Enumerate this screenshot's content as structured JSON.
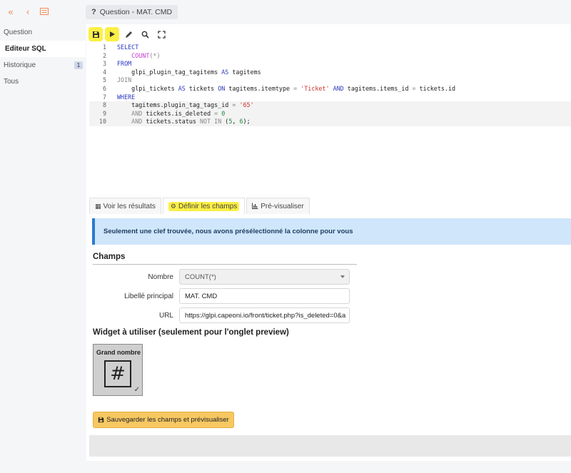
{
  "header": {
    "title_icon": "?",
    "title": "Question - MAT. CMD"
  },
  "sidebar": {
    "items": [
      {
        "label": "Question"
      },
      {
        "label": "Editeur SQL"
      },
      {
        "label": "Historique",
        "badge": "1"
      },
      {
        "label": "Tous"
      }
    ]
  },
  "toolbar": {
    "icons": [
      "save-icon",
      "play-icon",
      "pencil-icon",
      "search-icon",
      "fullscreen-icon"
    ]
  },
  "editor": {
    "lines": [
      {
        "n": "1",
        "tokens": [
          {
            "t": "SELECT",
            "c": "kw"
          }
        ]
      },
      {
        "n": "2",
        "tokens": [
          {
            "t": "    ",
            "c": "plain"
          },
          {
            "t": "COUNT",
            "c": "fn"
          },
          {
            "t": "(*)",
            "c": "gray"
          }
        ]
      },
      {
        "n": "3",
        "tokens": [
          {
            "t": "FROM",
            "c": "kw"
          }
        ]
      },
      {
        "n": "4",
        "tokens": [
          {
            "t": "    glpi_plugin_tag_tagitems ",
            "c": "plain"
          },
          {
            "t": "AS",
            "c": "kw"
          },
          {
            "t": " tagitems",
            "c": "plain"
          }
        ]
      },
      {
        "n": "5",
        "tokens": [
          {
            "t": "JOIN",
            "c": "gray"
          }
        ]
      },
      {
        "n": "6",
        "tokens": [
          {
            "t": "    glpi_tickets ",
            "c": "plain"
          },
          {
            "t": "AS",
            "c": "kw"
          },
          {
            "t": " tickets ",
            "c": "plain"
          },
          {
            "t": "ON",
            "c": "kw"
          },
          {
            "t": " tagitems.itemtype ",
            "c": "plain"
          },
          {
            "t": "=",
            "c": "gray"
          },
          {
            "t": " ",
            "c": "plain"
          },
          {
            "t": "'Ticket'",
            "c": "str"
          },
          {
            "t": " ",
            "c": "plain"
          },
          {
            "t": "AND",
            "c": "kw"
          },
          {
            "t": " tagitems.items_id ",
            "c": "plain"
          },
          {
            "t": "=",
            "c": "gray"
          },
          {
            "t": " tickets.id",
            "c": "plain"
          }
        ]
      },
      {
        "n": "7",
        "tokens": [
          {
            "t": "WHERE",
            "c": "kw"
          }
        ]
      },
      {
        "n": "8",
        "tokens": [
          {
            "t": "    tagitems.plugin_tag_tags_id ",
            "c": "plain"
          },
          {
            "t": "=",
            "c": "gray"
          },
          {
            "t": " ",
            "c": "plain"
          },
          {
            "t": "'65'",
            "c": "str"
          }
        ]
      },
      {
        "n": "9",
        "tokens": [
          {
            "t": "    ",
            "c": "plain"
          },
          {
            "t": "AND",
            "c": "gray"
          },
          {
            "t": " tickets.is_deleted ",
            "c": "plain"
          },
          {
            "t": "=",
            "c": "gray"
          },
          {
            "t": " ",
            "c": "plain"
          },
          {
            "t": "0",
            "c": "num"
          }
        ]
      },
      {
        "n": "10",
        "tokens": [
          {
            "t": "    ",
            "c": "plain"
          },
          {
            "t": "AND",
            "c": "gray"
          },
          {
            "t": " tickets.status ",
            "c": "plain"
          },
          {
            "t": "NOT IN",
            "c": "gray"
          },
          {
            "t": " (",
            "c": "plain"
          },
          {
            "t": "5",
            "c": "num"
          },
          {
            "t": ", ",
            "c": "plain"
          },
          {
            "t": "6",
            "c": "num"
          },
          {
            "t": ");",
            "c": "plain"
          }
        ]
      }
    ]
  },
  "tabs": [
    {
      "icon": "▦",
      "label": "Voir les résultats"
    },
    {
      "icon": "⚙",
      "label": "Définir les champs"
    },
    {
      "icon": "📊",
      "label": "Pré-visualiser"
    }
  ],
  "alert": {
    "text": "Seulement une clef trouvée, nous avons présélectionné la colonne pour vous"
  },
  "champs": {
    "title": "Champs",
    "nombre_label": "Nombre",
    "nombre_value": "COUNT(*)",
    "libelle_label": "Libellé principal",
    "libelle_value": "MAT. CMD",
    "url_label": "URL",
    "url_value": "https://glpi.capeoni.io/front/ticket.php?is_deleted=0&a"
  },
  "widget": {
    "title": "Widget à utiliser (seulement pour l'onglet preview)",
    "card_name": "Grand nombre",
    "card_glyph": "#",
    "check": "✓"
  },
  "actions": {
    "save_label": "Sauvegarder les champs et prévisualiser"
  },
  "colors": {
    "accent": "#f08c5a",
    "highlight": "#fcef45",
    "alert_bg": "#cfe6fb",
    "save_btn": "#f7c862"
  }
}
